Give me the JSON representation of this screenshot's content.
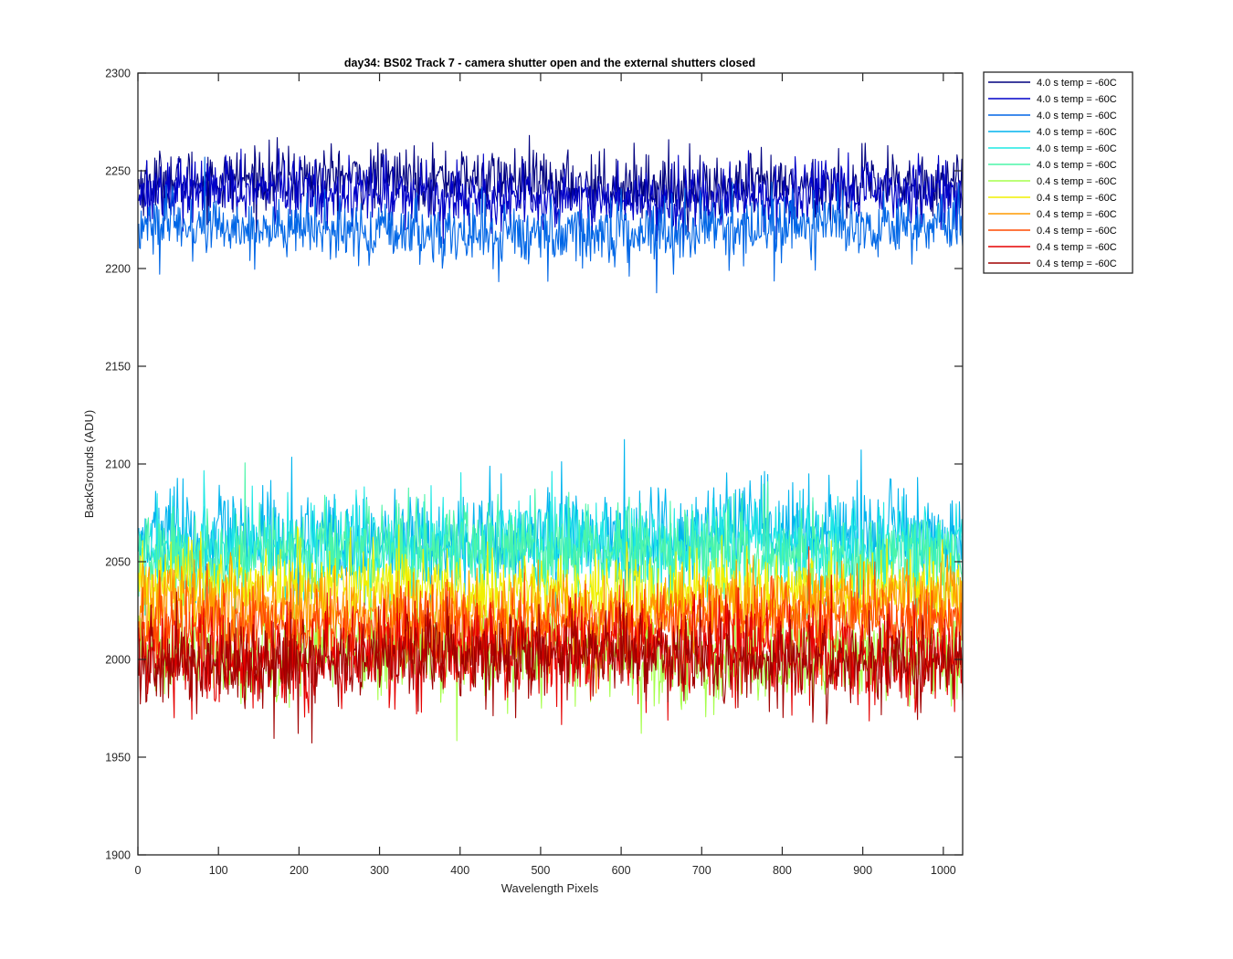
{
  "chart_data": {
    "type": "line",
    "title": "day34: BS02  Track 7 - camera shutter open and the external shutters closed",
    "xlabel": "Wavelength Pixels",
    "ylabel": "BackGrounds (ADU)",
    "xlim": [
      0,
      1024
    ],
    "ylim": [
      1900,
      2300
    ],
    "xticks": [
      0,
      100,
      200,
      300,
      400,
      500,
      600,
      700,
      800,
      900,
      1000
    ],
    "yticks": [
      1900,
      1950,
      2000,
      2050,
      2100,
      2150,
      2200,
      2250,
      2300
    ],
    "grid": false,
    "legend_position": "outside-right-top",
    "x": "1..1024 (wavelength pixel index)",
    "series": [
      {
        "name": "4.0 s temp = -60C",
        "color": "#00007f",
        "mean": 2244,
        "noise": 8
      },
      {
        "name": "4.0 s temp = -60C",
        "color": "#0000c8",
        "mean": 2238,
        "noise": 8
      },
      {
        "name": "4.0 s temp = -60C",
        "color": "#0066e6",
        "mean": 2220,
        "noise": 8
      },
      {
        "name": "4.0 s temp = -60C",
        "color": "#00b4ee",
        "mean": 2062,
        "noise": 13
      },
      {
        "name": "4.0 s temp = -60C",
        "color": "#1ee8e4",
        "mean": 2058,
        "noise": 12
      },
      {
        "name": "4.0 s temp = -60C",
        "color": "#4cf5a8",
        "mean": 2055,
        "noise": 12
      },
      {
        "name": "0.4 s temp = -60C",
        "color": "#a6ff4c",
        "mean": 2003,
        "noise": 12
      },
      {
        "name": "0.4 s temp = -60C",
        "color": "#f0f000",
        "mean": 2036,
        "noise": 10
      },
      {
        "name": "0.4 s temp = -60C",
        "color": "#ff9a00",
        "mean": 2026,
        "noise": 10
      },
      {
        "name": "0.4 s temp = -60C",
        "color": "#ff4a00",
        "mean": 2018,
        "noise": 10
      },
      {
        "name": "0.4 s temp = -60C",
        "color": "#e60000",
        "mean": 2002,
        "noise": 12
      },
      {
        "name": "0.4 s temp = -60C",
        "color": "#a00000",
        "mean": 2000,
        "noise": 11
      }
    ]
  }
}
